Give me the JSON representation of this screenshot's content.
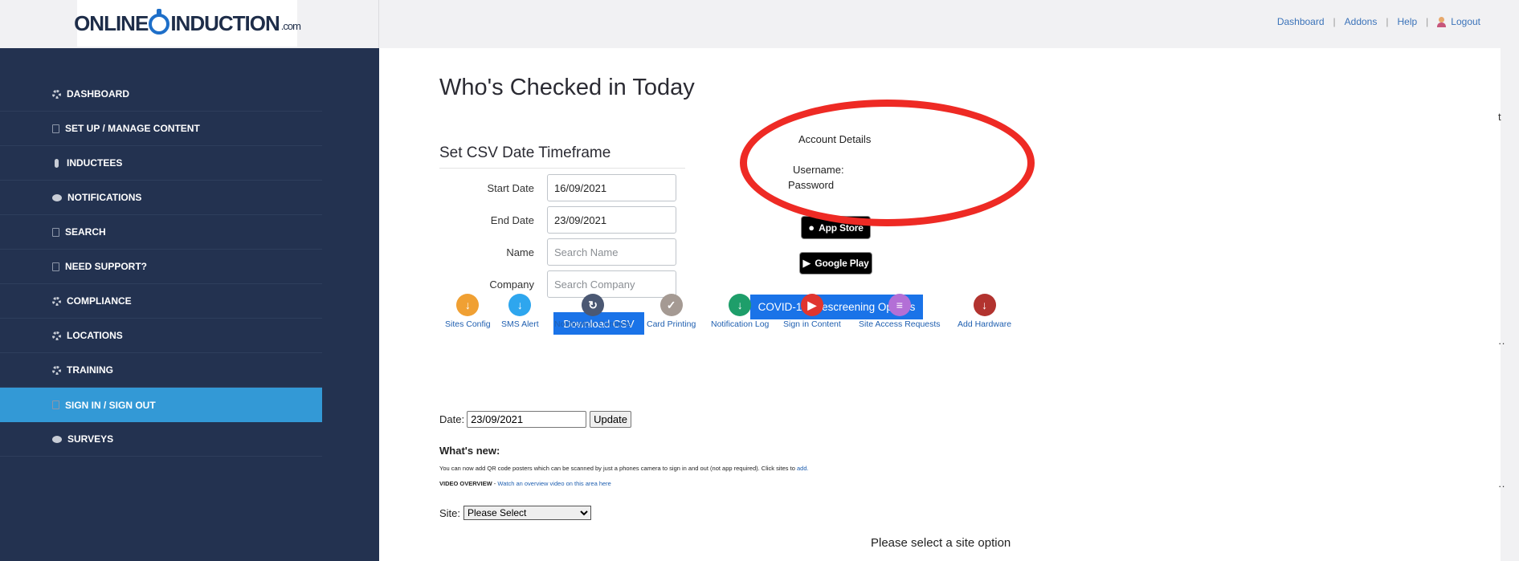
{
  "header": {
    "logo_text": "ONLINEINDUCTION.com",
    "logo_left": "ONLINE",
    "logo_right": "INDUCTION",
    "logo_suffix": ".com",
    "links": [
      {
        "label": "Dashboard"
      },
      {
        "label": "Addons"
      },
      {
        "label": "Help"
      },
      {
        "label": "Logout"
      }
    ],
    "separator": "|"
  },
  "sidebar": {
    "items": [
      {
        "label": "DASHBOARD",
        "icon": "gear-icon",
        "active": false
      },
      {
        "label": "SET UP / MANAGE CONTENT",
        "icon": "document-icon",
        "active": false
      },
      {
        "label": "INDUCTEES",
        "icon": "microphone-icon",
        "active": false
      },
      {
        "label": "NOTIFICATIONS",
        "icon": "chat-bubble-icon",
        "active": false
      },
      {
        "label": "SEARCH",
        "icon": "document-icon",
        "active": false
      },
      {
        "label": "NEED SUPPORT?",
        "icon": "document-icon",
        "active": false
      },
      {
        "label": "COMPLIANCE",
        "icon": "gear-icon",
        "active": false
      },
      {
        "label": "LOCATIONS",
        "icon": "gear-icon",
        "active": false
      },
      {
        "label": "TRAINING",
        "icon": "gear-icon",
        "active": false
      },
      {
        "label": "SIGN IN / SIGN OUT",
        "icon": "document-icon",
        "active": true
      },
      {
        "label": "SURVEYS",
        "icon": "chat-bubble-icon",
        "active": false
      }
    ]
  },
  "main": {
    "title": "Who's Checked in Today",
    "csv": {
      "heading": "Set CSV Date Timeframe",
      "start_label": "Start Date",
      "start_value": "16/09/2021",
      "end_label": "End Date",
      "end_value": "23/09/2021",
      "name_label": "Name",
      "name_placeholder": "Search Name",
      "company_label": "Company",
      "company_placeholder": "Search Company",
      "download_label": "Download CSV"
    },
    "account": {
      "heading": "Account Details",
      "username_label": "Username:",
      "password_label": "Password",
      "app_store_label": "App Store",
      "google_play_label": "Google Play",
      "covid_button": "COVID-19 Prescreening Options"
    },
    "quick_links": [
      {
        "label": "Sites Config",
        "color": "#f0a033",
        "icon": "download-arrow-icon"
      },
      {
        "label": "SMS Alert",
        "color": "#2ea6ee",
        "icon": "download-arrow-icon"
      },
      {
        "label": "Notification Contacts",
        "color": "#4b5873",
        "icon": "contacts-icon"
      },
      {
        "label": "Card Printing",
        "color": "#a59a93",
        "icon": "check-circle-icon"
      },
      {
        "label": "Notification Log",
        "color": "#1e9e6a",
        "icon": "download-arrow-icon"
      },
      {
        "label": "Sign in Content",
        "color": "#e0352f",
        "icon": "play-icon"
      },
      {
        "label": "Site Access Requests",
        "color": "#b36fd6",
        "icon": "list-icon"
      },
      {
        "label": "Add Hardware",
        "color": "#b2332f",
        "icon": "download-arrow-icon"
      }
    ],
    "date_filter": {
      "label": "Date:",
      "value": "23/09/2021",
      "button": "Update"
    },
    "whats_new": {
      "heading": "What's new:",
      "line1": "You can now add QR code posters which can be scanned by just a phones camera to sign in and out (not app required). Click sites to",
      "line1_link": "add.",
      "video_label": "VIDEO OVERVIEW",
      "video_sep": " - ",
      "video_link": "Watch an overview video on this area here"
    },
    "site": {
      "label": "Site:",
      "selected": "Please Select"
    },
    "select_message": "Please select a site option"
  },
  "edge": {
    "glyph_t": "t",
    "glyph_dots": "··"
  },
  "colors": {
    "sidebar_bg": "#233250",
    "active_item": "#3399d6",
    "primary_button": "#1a73e8",
    "annotation_ellipse": "#ee2a24",
    "link": "#3b73b9"
  }
}
